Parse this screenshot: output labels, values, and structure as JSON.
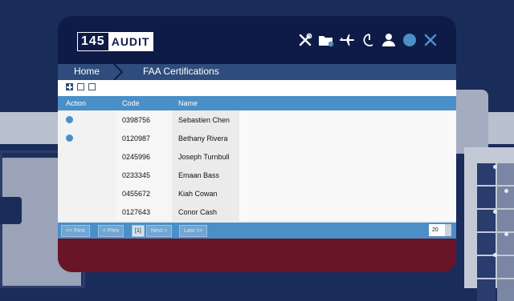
{
  "logo": {
    "number": "145",
    "word": "AUDIT"
  },
  "toolbar": {
    "icons": [
      "tools-icon",
      "folder-icon",
      "airplane-icon",
      "moon-icon",
      "user-icon",
      "circle-icon",
      "close-icon"
    ]
  },
  "breadcrumb": {
    "home": "Home",
    "current": "FAA Certifications"
  },
  "grid": {
    "headers": {
      "action": "Action",
      "code": "Code",
      "name": "Name"
    },
    "rows": [
      {
        "code": "0398756",
        "name": "Sebastien Chen"
      },
      {
        "code": "0120987",
        "name": "Bethany Rivera"
      },
      {
        "code": "0245996",
        "name": "Joseph Turnbull"
      },
      {
        "code": "0233345",
        "name": "Emaan Bass"
      },
      {
        "code": "0455672",
        "name": "Kiah Cowan"
      },
      {
        "code": "0127643",
        "name": "Conor Cash"
      }
    ]
  },
  "pager": {
    "first": "<< First",
    "prev": "< Prev",
    "current": "[1]",
    "next": "Next >",
    "last": "Last >>",
    "page_size": "20"
  },
  "colors": {
    "titlebar": "#0e1b47",
    "navbar": "#2f4d7c",
    "grid_header": "#4a8fc7",
    "footer": "#6a1427"
  }
}
